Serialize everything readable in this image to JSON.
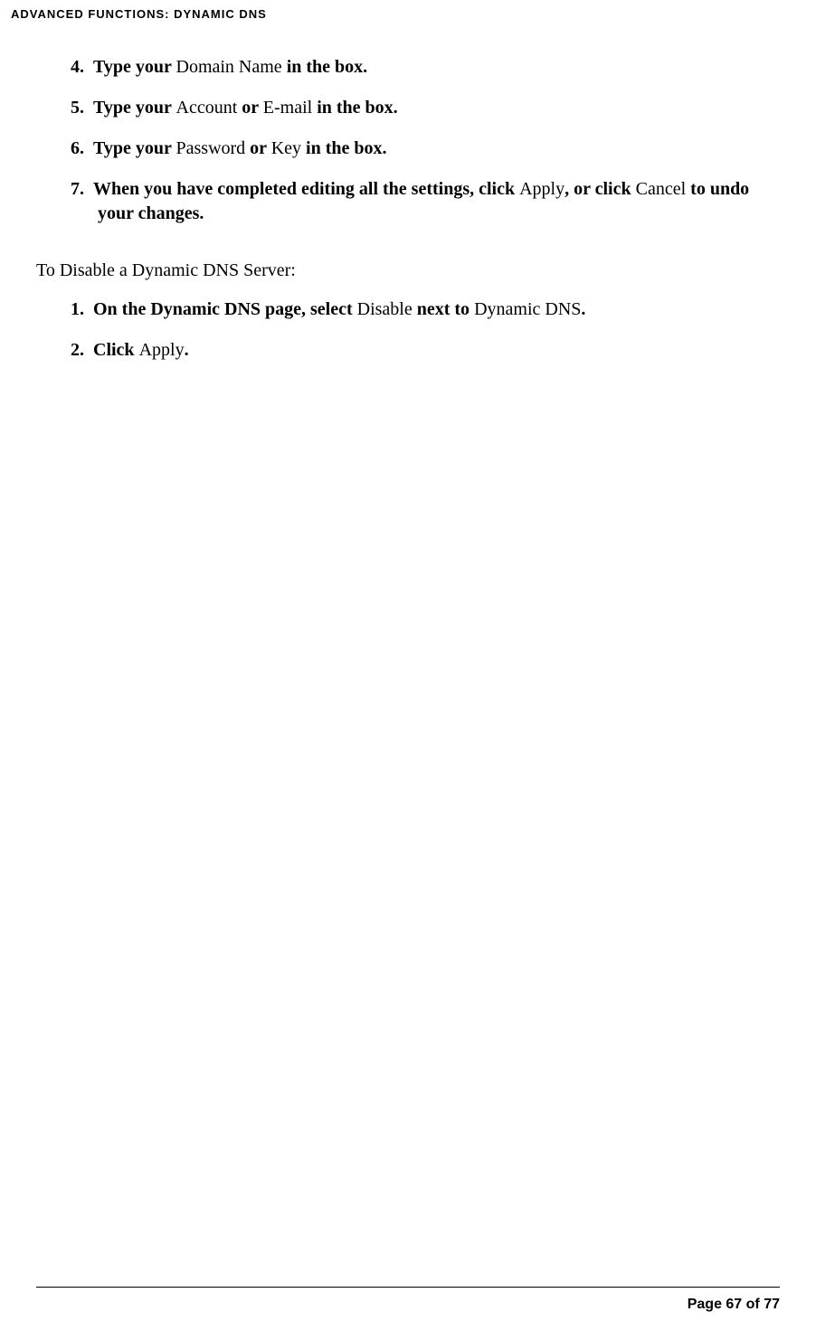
{
  "header": "ADVANCED FUNCTIONS: DYNAMIC DNS",
  "list1": {
    "item4": {
      "num": "4.",
      "part1": "Type your ",
      "part2": "Domain Name ",
      "part3": "in the box."
    },
    "item5": {
      "num": "5.",
      "part1": "Type your ",
      "part2": "Account ",
      "part3": "or ",
      "part4": "E-mail ",
      "part5": "in the box."
    },
    "item6": {
      "num": "6.",
      "part1": "Type your ",
      "part2": "Password ",
      "part3": "or ",
      "part4": "Key ",
      "part5": "in the box."
    },
    "item7": {
      "num": "7.",
      "part1": "When you have completed editing all the settings, click ",
      "part2": "Apply",
      "part3": ", or click ",
      "part4": "Cancel ",
      "part5": "to undo your changes."
    }
  },
  "section2_heading": "To Disable a Dynamic DNS Server:",
  "list2": {
    "item1": {
      "num": "1.",
      "part1": "On the Dynamic DNS page, select ",
      "part2": "Disable ",
      "part3": "next to ",
      "part4": "Dynamic DNS",
      "part5": "."
    },
    "item2": {
      "num": "2.",
      "part1": "Click ",
      "part2": "Apply",
      "part3": "."
    }
  },
  "footer": {
    "page": "Page 67 of 77"
  }
}
